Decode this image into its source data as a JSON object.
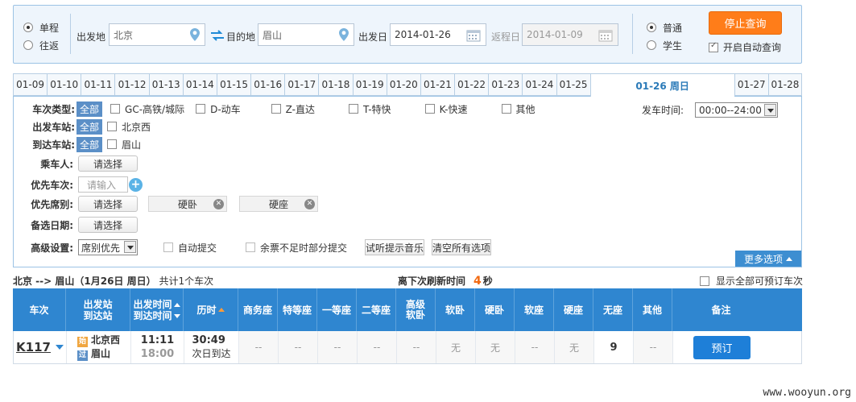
{
  "search": {
    "trip_types": [
      {
        "label": "单程",
        "selected": true
      },
      {
        "label": "往返",
        "selected": false
      }
    ],
    "from_label": "出发地",
    "from_value": "北京",
    "to_label": "目的地",
    "to_value": "眉山",
    "depart_label": "出发日",
    "depart_value": "2014-01-26",
    "return_label": "返程日",
    "return_value": "2014-01-09",
    "passenger_types": [
      {
        "label": "普通",
        "selected": true
      },
      {
        "label": "学生",
        "selected": false
      }
    ],
    "stop_button": "停止查询",
    "auto_query_label": "开启自动查询",
    "auto_query_checked": true
  },
  "date_tabs": [
    "01-09",
    "01-10",
    "01-11",
    "01-12",
    "01-13",
    "01-14",
    "01-15",
    "01-16",
    "01-17",
    "01-18",
    "01-19",
    "01-20",
    "01-21",
    "01-22",
    "01-23",
    "01-24",
    "01-25",
    "01-26 周日",
    "01-27",
    "01-28"
  ],
  "active_date_index": 17,
  "filters": {
    "train_type_label": "车次类型:",
    "all_label": "全部",
    "train_types": [
      "GC-高铁/城际",
      "D-动车",
      "Z-直达",
      "T-特快",
      "K-快速",
      "其他"
    ],
    "depart_station_label": "出发车站:",
    "depart_station": "北京西",
    "arrive_station_label": "到达车站:",
    "arrive_station": "眉山",
    "passenger_label": "乘车人:",
    "priority_train_label": "优先车次:",
    "priority_seat_label": "优先席别:",
    "backup_date_label": "备选日期:",
    "select_label": "请选择",
    "input_placeholder": "请输入",
    "seat_chips": [
      "硬卧",
      "硬座"
    ],
    "advanced_label": "高级设置:",
    "advanced_select": "席别优先",
    "auto_submit_label": "自动提交",
    "partial_submit_label": "余票不足时部分提交",
    "listen_music_button": "试听提示音乐",
    "clear_all_button": "清空所有选项",
    "depart_time_label": "发车时间:",
    "depart_time_value": "00:00--24:00",
    "more_options": "更多选项"
  },
  "summary": {
    "route": "北京 --> 眉山（1月26日  周日）",
    "count_text": "共计1个车次",
    "refresh_label": "离下次刷新时间",
    "refresh_seconds": "4",
    "refresh_unit": "秒",
    "show_all_label": "显示全部可预订车次"
  },
  "table": {
    "headers": {
      "train": "车次",
      "station_top": "出发站",
      "station_bottom": "到达站",
      "time_top": "出发时间",
      "time_bottom": "到达时间",
      "duration": "历时",
      "seats": [
        "商务座",
        "特等座",
        "一等座",
        "二等座",
        "高级软卧",
        "软卧",
        "硬卧",
        "软座",
        "硬座",
        "无座",
        "其他"
      ],
      "remark": "备注"
    },
    "rows": [
      {
        "train_no": "K117",
        "from_tag": "始",
        "from_station": "北京西",
        "to_tag": "过",
        "to_station": "眉山",
        "depart_time": "11:11",
        "arrive_time": "18:00",
        "duration": "30:49",
        "arrive_note": "次日到达",
        "seats": [
          "--",
          "--",
          "--",
          "--",
          "--",
          "无",
          "无",
          "--",
          "无",
          "9",
          "--"
        ],
        "book_label": "预订"
      }
    ]
  },
  "watermark": "www.wooyun.org"
}
